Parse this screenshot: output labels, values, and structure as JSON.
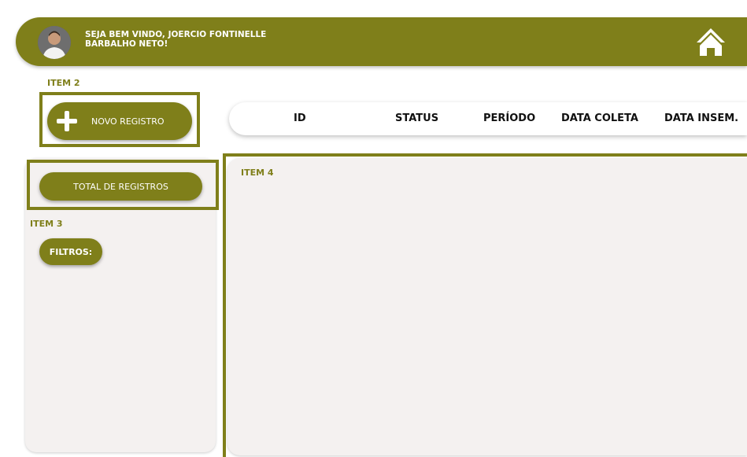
{
  "header": {
    "welcome_line1": "SEJA BEM VINDO, JOERCIO FONTINELLE",
    "welcome_line2": "BARBALHO NETO!",
    "home_icon": "home-icon",
    "color": "#7f7f1a"
  },
  "item2": {
    "label": "ITEM 2",
    "new_record_label": "NOVO REGISTRO",
    "icon": "plus-icon"
  },
  "table": {
    "columns": [
      "ID",
      "STATUS",
      "PERÍODO",
      "DATA COLETA",
      "DATA INSEM."
    ]
  },
  "sidebar": {
    "total_label": "TOTAL DE REGISTROS",
    "item3_label": "ITEM 3",
    "filters_label": "FILTROS:"
  },
  "main": {
    "item4_label": "ITEM 4"
  }
}
